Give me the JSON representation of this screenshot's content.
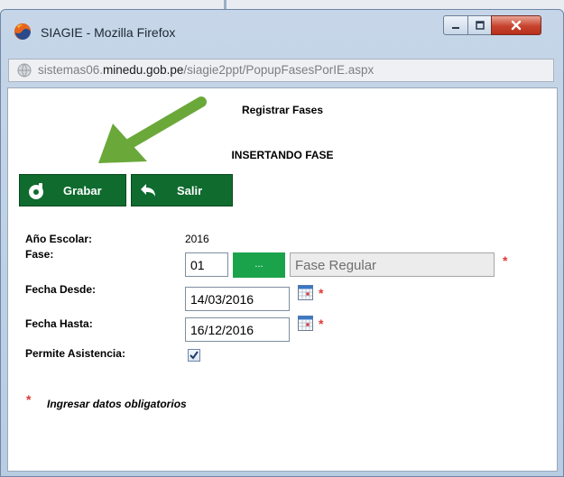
{
  "window": {
    "title": "SIAGIE - Mozilla Firefox",
    "url_prefix": "sistemas06.",
    "url_domain": "minedu.gob.pe",
    "url_path": "/siagie2ppt/PopupFasesPorIE.aspx"
  },
  "page": {
    "heading": "Registrar Fases",
    "subheading": "INSERTANDO FASE",
    "toolbar": {
      "save_label": "Grabar",
      "exit_label": "Salir"
    }
  },
  "form": {
    "year": {
      "label": "Año Escolar:",
      "value": "2016"
    },
    "phase": {
      "label": "Fase:",
      "code": "01",
      "lookup_label": "...",
      "name": "Fase Regular"
    },
    "date_from": {
      "label": "Fecha Desde:",
      "value": "14/03/2016"
    },
    "date_to": {
      "label": "Fecha Hasta:",
      "value": "16/12/2016"
    },
    "attendance": {
      "label": "Permite Asistencia:",
      "checked": true
    }
  },
  "required_mark": "*",
  "note": "Ingresar datos obligatorios",
  "colors": {
    "toolbar_green": "#0f6b2e",
    "lookup_green": "#1aa34b",
    "required_red": "#e23838",
    "annotation_arrow": "#6aa83a"
  }
}
